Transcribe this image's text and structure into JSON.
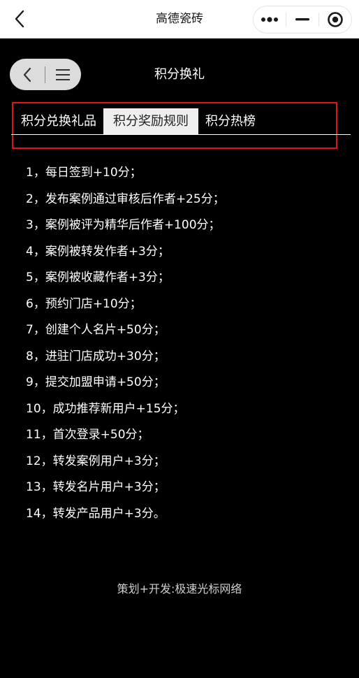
{
  "header": {
    "app_title": "高德瓷砖"
  },
  "page": {
    "title": "积分换礼"
  },
  "tabs": [
    {
      "label": "积分兑换礼品",
      "active": false
    },
    {
      "label": "积分奖励规则",
      "active": true
    },
    {
      "label": "积分热榜",
      "active": false
    }
  ],
  "rules": [
    "1，每日签到+10分；",
    "2，发布案例通过审核后作者+25分；",
    "3，案例被评为精华后作者+100分；",
    "4，案例被转发作者+3分；",
    "5，案例被收藏作者+3分；",
    "6，预约门店+10分；",
    "7，创建个人名片+50分；",
    "8，进驻门店成功+30分；",
    "9，提交加盟申请+50分；",
    "10，成功推荐新用户+15分；",
    "11，首次登录+50分；",
    "12，转发案例用户+3分；",
    "13，转发名片用户+3分；",
    "14，转发产品用户+3分。"
  ],
  "footer": {
    "credit": "策划+开发:极速光标网络"
  },
  "colors": {
    "background": "#000000",
    "highlight_border": "#e0121a",
    "active_tab_bg": "#efefef"
  },
  "icons": {
    "back": "back-arrow-icon",
    "more": "more-dots-icon",
    "minimize": "minimize-icon",
    "close": "target-close-icon",
    "pill_back": "chevron-left-icon",
    "pill_menu": "menu-icon"
  }
}
